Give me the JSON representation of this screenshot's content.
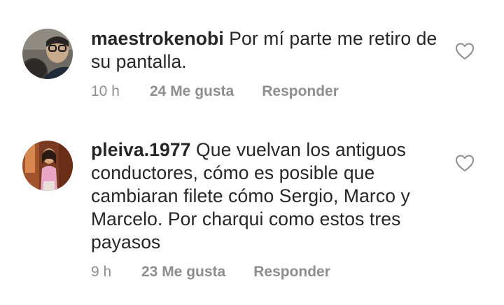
{
  "comments": [
    {
      "username": "maestrokenobi",
      "text": "Por mí parte me retiro de su pantalla.",
      "time": "10 h",
      "likes": "24 Me gusta",
      "reply": "Responder",
      "like_icon": "heart-outline-icon"
    },
    {
      "username": "pleiva.1977",
      "text": "Que vuelvan los antiguos conductores, cómo es posible que cambiaran filete cómo Sergio, Marco y Marcelo. Por charqui como estos tres payasos",
      "time": "9 h",
      "likes": "23 Me gusta",
      "reply": "Responder",
      "like_icon": "heart-outline-icon"
    }
  ],
  "colors": {
    "text": "#262626",
    "secondary": "#8e8e8e",
    "background": "#ffffff"
  }
}
